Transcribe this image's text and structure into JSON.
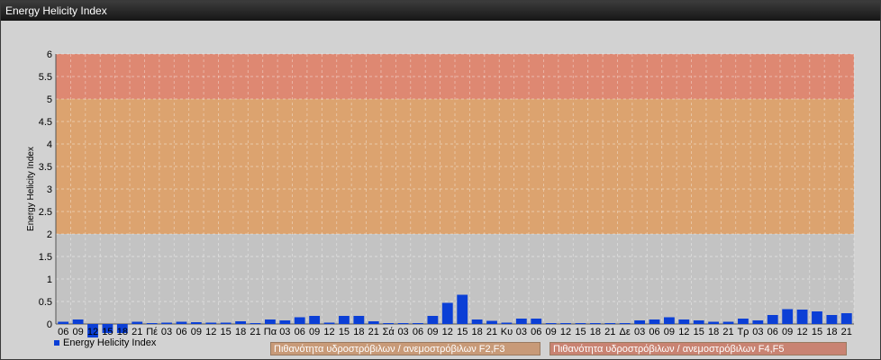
{
  "window": {
    "title": "Energy Helicity Index"
  },
  "colors": {
    "bar": "#0b3fd6",
    "band_low": "#c3c3c3",
    "band_mid": "#dca36f",
    "band_high": "#de8872",
    "grid": "#ffffff"
  },
  "legend": {
    "series_label": "Energy Helicity Index"
  },
  "bands": [
    {
      "label": "Πιθανότητα υδροστρόβιλων / ανεμοστρόβιλων F2,F3",
      "from": 2,
      "to": 5,
      "color": "#c89a78"
    },
    {
      "label": "Πιθανότητα υδροστρόβιλων / ανεμοστρόβιλων F4,F5",
      "from": 5,
      "to": 6,
      "color": "#c98372"
    }
  ],
  "chart_data": {
    "type": "bar",
    "title": "",
    "ylabel": "Energy Helicity Index",
    "xlabel": "",
    "ylim": [
      0,
      6
    ],
    "yticks": [
      "0",
      "0.5",
      "1",
      "1.5",
      "2",
      "2.5",
      "3",
      "3.5",
      "4",
      "4.5",
      "5",
      "5.5",
      "6"
    ],
    "categories": [
      "06",
      "09",
      "12",
      "15",
      "18",
      "21",
      "Πέ",
      "03",
      "06",
      "09",
      "12",
      "15",
      "18",
      "21",
      "Πα",
      "03",
      "06",
      "09",
      "12",
      "15",
      "18",
      "21",
      "Σά",
      "03",
      "06",
      "09",
      "12",
      "15",
      "18",
      "21",
      "Κυ",
      "03",
      "06",
      "09",
      "12",
      "15",
      "18",
      "21",
      "Δε",
      "03",
      "06",
      "09",
      "12",
      "15",
      "18",
      "21",
      "Τρ",
      "03",
      "06",
      "09",
      "12",
      "15",
      "18",
      "21"
    ],
    "series": [
      {
        "name": "Energy Helicity Index",
        "values": [
          0.05,
          0.1,
          -0.3,
          -0.2,
          -0.2,
          0.05,
          0.02,
          0.03,
          0.05,
          0.04,
          0.03,
          0.03,
          0.06,
          0.02,
          0.1,
          0.08,
          0.15,
          0.18,
          0.03,
          0.18,
          0.18,
          0.06,
          0.02,
          0.02,
          0.02,
          0.18,
          0.47,
          0.65,
          0.1,
          0.07,
          0.03,
          0.12,
          0.12,
          0.02,
          0.02,
          0.02,
          0.02,
          0.02,
          0.02,
          0.08,
          0.1,
          0.15,
          0.1,
          0.08,
          0.05,
          0.05,
          0.12,
          0.08,
          0.2,
          0.33,
          0.32,
          0.28,
          0.2,
          0.24
        ]
      }
    ]
  }
}
